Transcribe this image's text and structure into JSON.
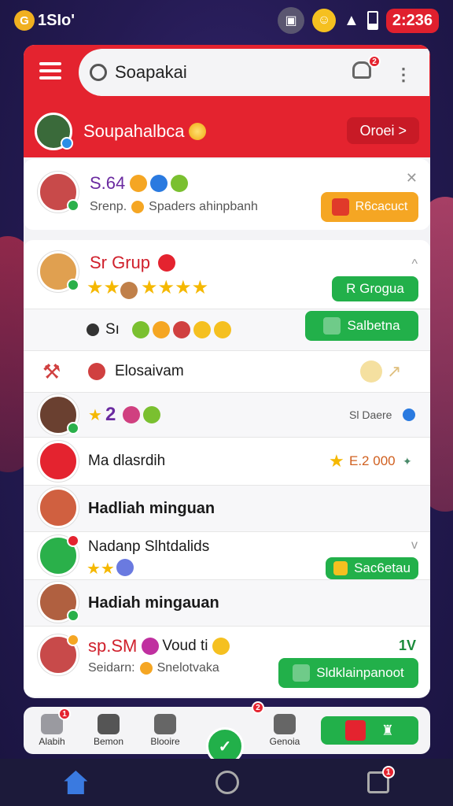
{
  "status_bar": {
    "app_label": "1SIo'",
    "time": "2:236"
  },
  "search": {
    "value": "Soapakai"
  },
  "header_badge": "2",
  "profile": {
    "name": "Soupahalbca",
    "button_label": "Oroei >"
  },
  "notice": {
    "title": "S.64",
    "subtitle_label": "Srenp.",
    "subtitle_text": "Spaders ahinpbanh",
    "button_label": "R6cacuct"
  },
  "group": {
    "title": "Sr Grup",
    "button_label": "R Grogua"
  },
  "row_sl": {
    "label": "Sı",
    "button_label": "Salbetna"
  },
  "row_broadcast": {
    "label": "Elosaivam"
  },
  "row_score": {
    "value": "2",
    "right_label": "Sl Daere"
  },
  "row_reward": {
    "label": "Ma dlasrdih",
    "value": "E.2 000"
  },
  "row_weekly1": {
    "label": "Hadliah minguan"
  },
  "row_nadanp": {
    "label": "Nadanp Slhtdalids",
    "button_label": "Sac6etau"
  },
  "row_weekly2": {
    "label": "Hadiah mingauan"
  },
  "row_spsm": {
    "title": "sp.SM",
    "title_suffix": "Voud ti",
    "right_label": "1V",
    "subtitle_label": "Seidarn:",
    "subtitle_text": "Snelotvaka",
    "button_label": "Sldklainpanoot"
  },
  "tabs": [
    {
      "label": "Alabih",
      "badge": "1"
    },
    {
      "label": "Bemon"
    },
    {
      "label": "Blooire"
    },
    {
      "label": ""
    },
    {
      "label": "Genoia",
      "badge": "2"
    },
    {
      "label": ""
    }
  ],
  "sys_badge": "1"
}
